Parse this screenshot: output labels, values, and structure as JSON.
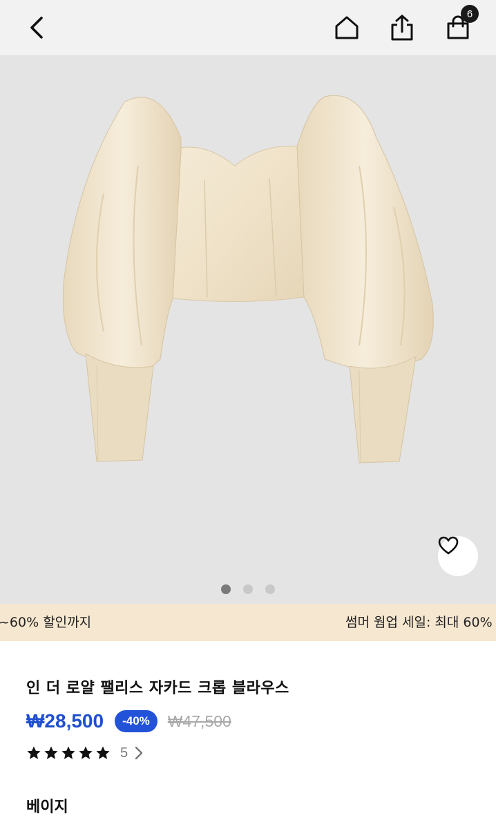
{
  "header": {
    "cart_count": "6"
  },
  "promo": {
    "left_text": "~60% 할인까지",
    "right_text": "썸머 웜업 세일: 최대 60%"
  },
  "product": {
    "title": "인 더 로얄 팰리스 자카드 크롭 블라우스",
    "price": "₩28,500",
    "discount": "-40%",
    "original_price": "₩47,500",
    "rating": 5,
    "review_count": "5",
    "color": "베이지"
  },
  "gallery": {
    "total_images": 3,
    "active_index": 0
  },
  "colors": {
    "accent": "#2252d8",
    "price": "#1f4fcf",
    "promo_bg": "#f6e7d0",
    "hero_bg": "#e4e4e4"
  }
}
